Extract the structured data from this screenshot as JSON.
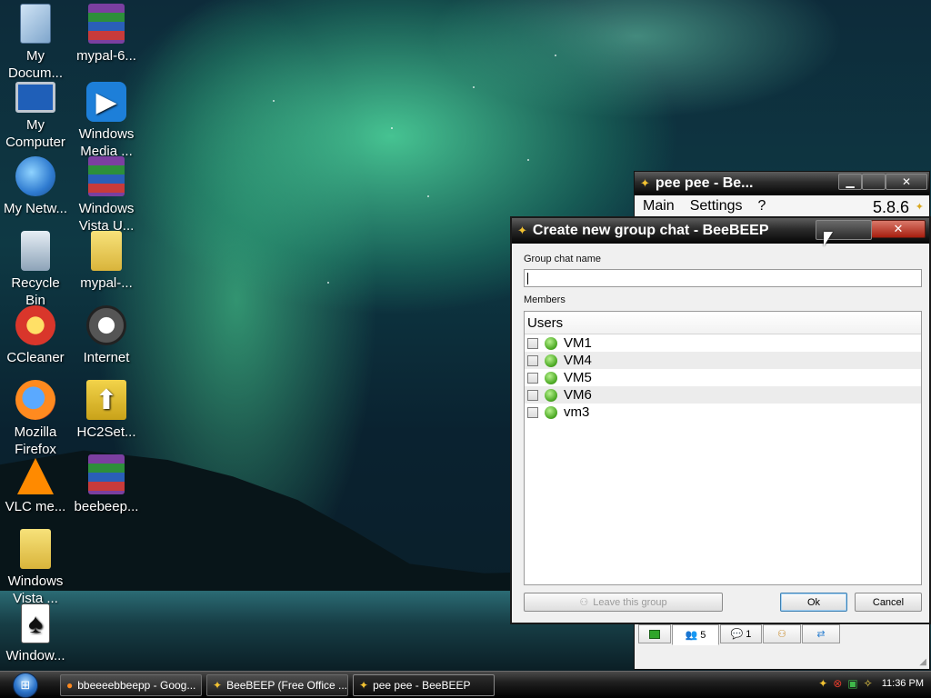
{
  "desktop": {
    "icons": [
      {
        "label": "My Docum...",
        "icon": "my-documents-icon"
      },
      {
        "label": "mypal-6...",
        "icon": "winrar-archive-icon"
      },
      {
        "label": "My Computer",
        "icon": "my-computer-icon"
      },
      {
        "label": "Windows Media ...",
        "icon": "windows-media-player-icon"
      },
      {
        "label": "My Netw...",
        "icon": "my-network-icon"
      },
      {
        "label": "Windows Vista U...",
        "icon": "winrar-archive-icon"
      },
      {
        "label": "Recycle Bin",
        "icon": "recycle-bin-icon"
      },
      {
        "label": "mypal-...",
        "icon": "folder-icon"
      },
      {
        "label": "CCleaner",
        "icon": "ccleaner-icon"
      },
      {
        "label": "Internet",
        "icon": "raccoon-browser-icon"
      },
      {
        "label": "Mozilla Firefox",
        "icon": "firefox-icon"
      },
      {
        "label": "HC2Set...",
        "icon": "setup-archive-icon"
      },
      {
        "label": "VLC me...",
        "icon": "vlc-icon"
      },
      {
        "label": "beebeep...",
        "icon": "winrar-archive-icon"
      },
      {
        "label": "Windows Vista ...",
        "icon": "folder-icon"
      },
      {
        "label": "Window...",
        "icon": "solitaire-icon"
      }
    ]
  },
  "main_window": {
    "title": "pee pee - Be...",
    "menu": [
      "Main",
      "Settings",
      "?"
    ],
    "version": "5.8.6",
    "toolbar": [
      {
        "icon": "green-status-icon",
        "count": ""
      },
      {
        "icon": "users-icon",
        "count": "5"
      },
      {
        "icon": "chat-icon",
        "count": "1"
      },
      {
        "icon": "group-icon",
        "count": ""
      },
      {
        "icon": "share-icon",
        "count": ""
      }
    ]
  },
  "dialog": {
    "title": "Create new group chat - BeeBEEP",
    "group_name_label": "Group chat name",
    "group_name_value": "",
    "members_label": "Members",
    "list_header": "Users",
    "members": [
      {
        "name": "VM1",
        "status": "online"
      },
      {
        "name": "VM4",
        "status": "online"
      },
      {
        "name": "VM5",
        "status": "online"
      },
      {
        "name": "VM6",
        "status": "online"
      },
      {
        "name": "vm3",
        "status": "online"
      }
    ],
    "leave_label": "Leave this group",
    "ok_label": "Ok",
    "cancel_label": "Cancel"
  },
  "taskbar": {
    "tasks": [
      {
        "label": "bbeeeebbeepp - Goog...",
        "icon": "firefox-icon"
      },
      {
        "label": "BeeBEEP (Free Office ...",
        "icon": "bee-icon"
      },
      {
        "label": "pee pee - BeeBEEP",
        "icon": "bee-icon"
      }
    ],
    "clock": "11:36 PM"
  }
}
